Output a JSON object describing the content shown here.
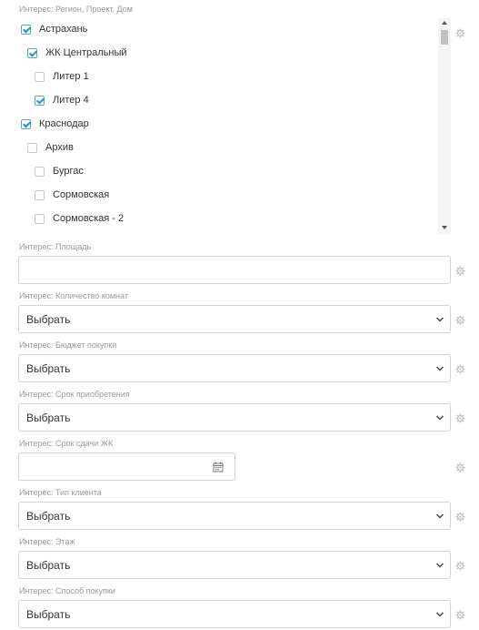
{
  "region": {
    "label": "Интерес: Регион, Проект, Дом",
    "items": [
      {
        "label": "Астрахань",
        "checked": true
      },
      {
        "label": "ЖК Центральный",
        "checked": true
      },
      {
        "label": "Литер 1",
        "checked": false
      },
      {
        "label": "Литер 4",
        "checked": true
      },
      {
        "label": "Краснодар",
        "checked": true
      },
      {
        "label": "Архив",
        "checked": false
      },
      {
        "label": "Бургас",
        "checked": false
      },
      {
        "label": "Сормовская",
        "checked": false
      },
      {
        "label": "Сормовская - 2",
        "checked": false
      }
    ]
  },
  "area": {
    "label": "Интерес: Площадь",
    "value": ""
  },
  "rooms": {
    "label": "Интерес: Количество комнат",
    "value": "Выбрать"
  },
  "budget": {
    "label": "Интерес: Бюджет покупки",
    "value": "Выбрать"
  },
  "purchase_term": {
    "label": "Интерес: Срок приобретения",
    "value": "Выбрать"
  },
  "delivery_date": {
    "label": "Интерес: Срок сдачи ЖК",
    "value": ""
  },
  "client_type": {
    "label": "Интерес: Тип клиента",
    "value": "Выбрать"
  },
  "floor": {
    "label": "Интерес: Этаж",
    "value": "Выбрать"
  },
  "payment_method": {
    "label": "Интерес: Способ покупки",
    "value": "Выбрать"
  },
  "colors": {
    "accent": "#2e8fd0",
    "border": "#d4d4d4",
    "label": "#9a9a9a"
  }
}
